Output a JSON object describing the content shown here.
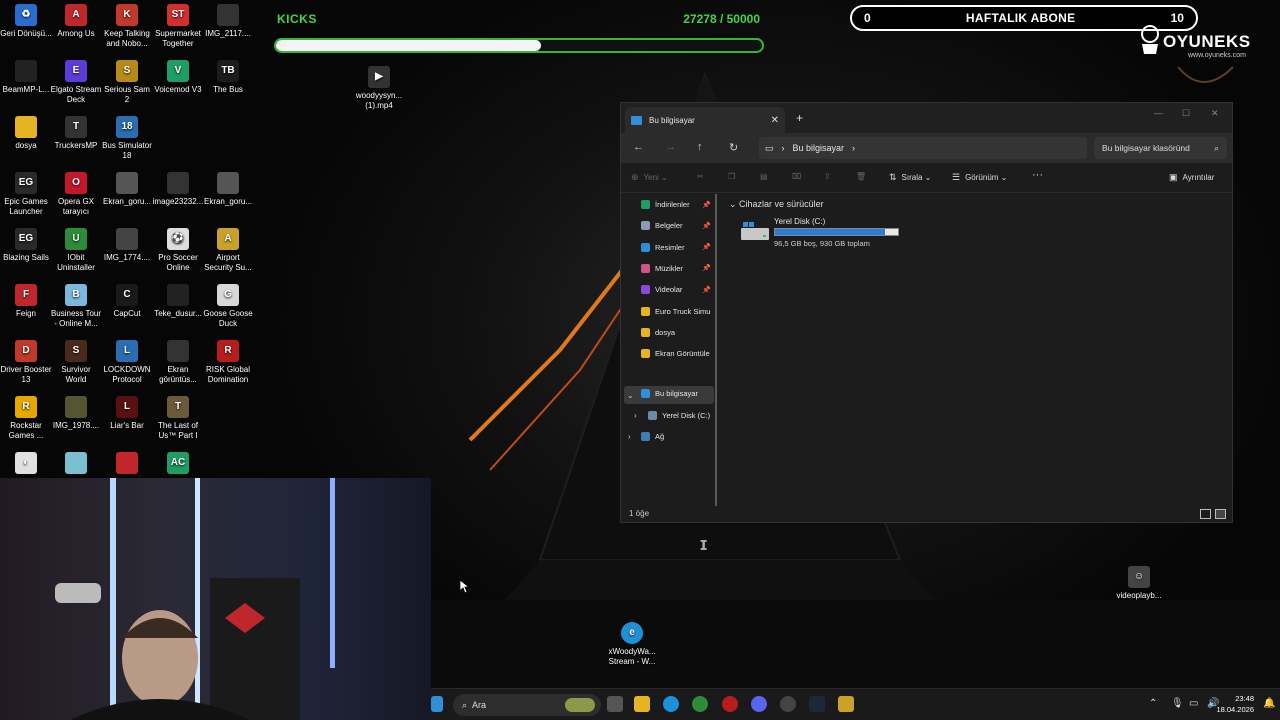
{
  "overlay": {
    "kicks_label": "KICKS",
    "kicks_count": "27278 / 50000",
    "kicks_progress": 0.5456,
    "abone_left": "0",
    "abone_title": "HAFTALIK ABONE",
    "abone_right": "10",
    "brand": "OYUNEKS",
    "brand_url": "www.oyuneks.com"
  },
  "desktop_icons": [
    {
      "label": "Geri Dönüşü...",
      "color": "#2b6ccf",
      "glyph": "♻"
    },
    {
      "label": "Among Us",
      "color": "#c0272d",
      "glyph": "A"
    },
    {
      "label": "Keep Talking and Nobo...",
      "color": "#c0392b",
      "glyph": "K"
    },
    {
      "label": "Supermarket Together",
      "color": "#d32f2f",
      "glyph": "ST"
    },
    {
      "label": "IMG_2117....",
      "color": "#333333",
      "glyph": ""
    },
    {
      "label": "BeamMP-L...",
      "color": "#222222",
      "glyph": ""
    },
    {
      "label": "Elgato Stream Deck",
      "color": "#5c3bd6",
      "glyph": "E"
    },
    {
      "label": "Serious Sam 2",
      "color": "#b58a18",
      "glyph": "S"
    },
    {
      "label": "Voicemod V3",
      "color": "#1e9e64",
      "glyph": "V"
    },
    {
      "label": "The Bus",
      "color": "#1c1c1c",
      "glyph": "TB"
    },
    {
      "label": "dosya",
      "color": "#e6b422",
      "glyph": ""
    },
    {
      "label": "TruckersMP",
      "color": "#333333",
      "glyph": "T"
    },
    {
      "label": "Bus Simulator 18",
      "color": "#2a6db0",
      "glyph": "18"
    },
    {
      "label": "Epic Games Launcher",
      "color": "#2a2a2a",
      "glyph": "EG"
    },
    {
      "label": "Opera GX tarayıcı",
      "color": "#c4172c",
      "glyph": "O"
    },
    {
      "label": "Ekran_goru...",
      "color": "#555555",
      "glyph": ""
    },
    {
      "label": "image23232...",
      "color": "#333333",
      "glyph": ""
    },
    {
      "label": "Ekran_goru...",
      "color": "#555555",
      "glyph": ""
    },
    {
      "label": "Blazing Sails",
      "color": "#2a2a2a",
      "glyph": "EG"
    },
    {
      "label": "IObit Uninstaller",
      "color": "#2e8b3a",
      "glyph": "U"
    },
    {
      "label": "IMG_1774....",
      "color": "#444444",
      "glyph": ""
    },
    {
      "label": "Pro Soccer Online",
      "color": "#dddddd",
      "glyph": "⚽"
    },
    {
      "label": "Airport Security Su...",
      "color": "#c9a227",
      "glyph": "A"
    },
    {
      "label": "Feign",
      "color": "#c0272d",
      "glyph": "F"
    },
    {
      "label": "Business Tour - Online M...",
      "color": "#7ab8e0",
      "glyph": "B"
    },
    {
      "label": "CapCut",
      "color": "#1a1a1a",
      "glyph": "C"
    },
    {
      "label": "Teke_dusur...",
      "color": "#222222",
      "glyph": ""
    },
    {
      "label": "Goose Goose Duck",
      "color": "#d8d8d8",
      "glyph": "G"
    },
    {
      "label": "Driver Booster 13",
      "color": "#c0392b",
      "glyph": "D"
    },
    {
      "label": "Survivor World",
      "color": "#4a2a1a",
      "glyph": "S"
    },
    {
      "label": "LOCKDOWN Protocol",
      "color": "#2a6db0",
      "glyph": "L"
    },
    {
      "label": "Ekran görüntüs...",
      "color": "#333333",
      "glyph": ""
    },
    {
      "label": "RISK Global Domination",
      "color": "#b91c1c",
      "glyph": "R"
    },
    {
      "label": "Rockstar Games ...",
      "color": "#e6a800",
      "glyph": "R"
    },
    {
      "label": "IMG_1978....",
      "color": "#555533",
      "glyph": ""
    },
    {
      "label": "Liar's Bar",
      "color": "#5a1010",
      "glyph": "L"
    },
    {
      "label": "The Last of Us™ Part I",
      "color": "#6a5a3a",
      "glyph": "T"
    },
    {
      "label": "",
      "color": "#e0e0e0",
      "glyph": "◐"
    },
    {
      "label": "",
      "color": "#7ac0d0",
      "glyph": ""
    },
    {
      "label": "",
      "color": "#c0272d",
      "glyph": ""
    },
    {
      "label": "",
      "color": "#1e9e64",
      "glyph": "AC"
    }
  ],
  "floating_icons": {
    "video_file": "woodyysyn... (1).mp4",
    "videoplay": "videoplayb...",
    "stream": "xWoodyWa... Stream - W..."
  },
  "explorer": {
    "tab_title": "Bu bilgisayar",
    "address": "Bu bilgisayar",
    "search_placeholder": "Bu bilgisayar klasöründ",
    "cmd_new": "Yeni",
    "cmd_sort": "Sırala",
    "cmd_view": "Görünüm",
    "cmd_more": "···",
    "cmd_details": "Ayrıntılar",
    "sidebar": [
      {
        "label": "İndirilenler",
        "color": "#1e9e64",
        "pinned": true
      },
      {
        "label": "Belgeler",
        "color": "#8a9ab0",
        "pinned": true
      },
      {
        "label": "Resimler",
        "color": "#2a8fd8",
        "pinned": true
      },
      {
        "label": "Müzikler",
        "color": "#d0548a",
        "pinned": true
      },
      {
        "label": "Videolar",
        "color": "#8a4ad8",
        "pinned": true
      },
      {
        "label": "Euro Truck Simu",
        "color": "#e6b422",
        "pinned": false
      },
      {
        "label": "dosya",
        "color": "#e6b422",
        "pinned": false
      },
      {
        "label": "Ekran Görüntüle",
        "color": "#e6b422",
        "pinned": false
      }
    ],
    "tree_this_pc": "Bu bilgisayar",
    "tree_drive": "Yerel Disk (C:)",
    "tree_network": "Ağ",
    "group_header": "Cihazlar ve sürücüler",
    "drive_name": "Yerel Disk (C:)",
    "drive_used_fraction": 0.896,
    "drive_free": "96,5 GB boş, 930 GB toplam",
    "status": "1 öğe"
  },
  "taskbar": {
    "search_label": "Ara",
    "time": "23:48",
    "date": "18.04.2026"
  }
}
